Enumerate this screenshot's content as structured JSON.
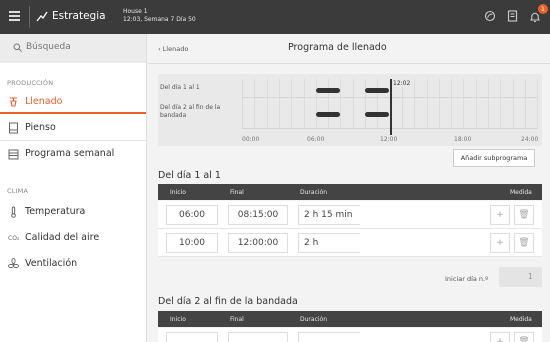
{
  "topbar": {
    "title": "Estrategia",
    "house_name": "House 1",
    "house_time": "12:03, Semana 7 Día 50",
    "notifications": "1",
    "icons": [
      "menu-icon",
      "trend-icon",
      "leaf-icon",
      "document-icon",
      "bell-icon"
    ]
  },
  "sidebar": {
    "search_placeholder": "Búsqueda",
    "section_production": "PRODUCCIÓN",
    "section_climate": "CLIMA",
    "items": [
      {
        "label": "Llenado",
        "icon": "tap-icon",
        "active": true
      },
      {
        "label": "Pienso",
        "icon": "feed-icon"
      },
      {
        "label": "Programa semanal",
        "icon": "calendar-icon"
      },
      {
        "label": "Temperatura",
        "icon": "thermometer-icon"
      },
      {
        "label": "Calidad del aire",
        "icon": "co2-icon"
      },
      {
        "label": "Ventilación",
        "icon": "fan-icon"
      }
    ],
    "accent": "#e8602c"
  },
  "main": {
    "breadcrumb": "‹ Llenado",
    "title": "Programa de llenado",
    "timeline": {
      "rows": [
        "Del día 1 al 1",
        "Del día 2 al fin de la bandada"
      ],
      "ticks": [
        "00:00",
        "06:00",
        "12:00",
        "18:00",
        "24:00"
      ],
      "now": "12:02"
    },
    "add_button": "Añadir subprograma",
    "columns": [
      "Inicio",
      "Final",
      "Duración",
      "Medida"
    ],
    "programs": [
      {
        "title": "Del día 1 al 1",
        "rows": [
          {
            "start": "06:00",
            "end": "08:15:00",
            "duration": "2 h 15 min"
          },
          {
            "start": "10:00",
            "end": "12:00:00",
            "duration": "2 h"
          }
        ]
      },
      {
        "title": "Del día 2 al fin de la bandada",
        "rows": []
      }
    ],
    "start_day_label": "Iniciar día n.º",
    "start_day_value": "1"
  }
}
